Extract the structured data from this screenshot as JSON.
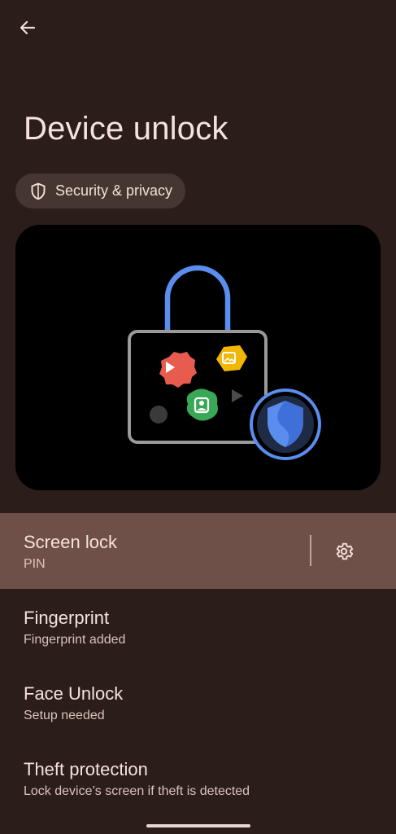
{
  "header": {
    "back_icon": "arrow-back-icon",
    "title": "Device unlock"
  },
  "breadcrumb_chip": {
    "icon": "shield-icon",
    "label": "Security & privacy"
  },
  "hero_illustration": {
    "icons": [
      "lock-icon",
      "play-badge-icon",
      "photo-badge-icon",
      "contact-badge-icon",
      "shield-badge-icon"
    ]
  },
  "settings": [
    {
      "title": "Screen lock",
      "subtitle": "PIN",
      "selected": true,
      "action_icon": "gear-icon"
    },
    {
      "title": "Fingerprint",
      "subtitle": "Fingerprint added"
    },
    {
      "title": "Face Unlock",
      "subtitle": "Setup needed"
    },
    {
      "title": "Theft protection",
      "subtitle": "Lock device’s screen if theft is detected"
    }
  ],
  "colors": {
    "background": "#2b1d1a",
    "selected_row": "#6f5049",
    "chip": "#453632",
    "accent_blue": "#5b8def"
  }
}
